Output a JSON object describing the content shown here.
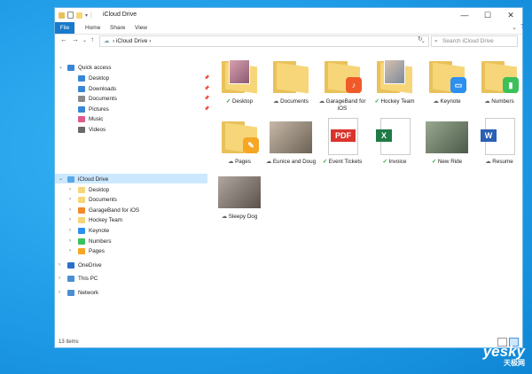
{
  "window": {
    "title": "iCloud Drive"
  },
  "ribbon": {
    "tabs": [
      "File",
      "Home",
      "Share",
      "View"
    ]
  },
  "address": {
    "path": "iCloud Drive",
    "search_placeholder": "Search iCloud Drive"
  },
  "sidebar": {
    "quick_access": {
      "label": "Quick access",
      "items": [
        "Desktop",
        "Downloads",
        "Documents",
        "Pictures",
        "Music",
        "Videos"
      ]
    },
    "icloud": {
      "label": "iCloud Drive",
      "items": [
        "Desktop",
        "Documents",
        "GarageBand for iOS",
        "Hockey Team",
        "Keynote",
        "Numbers",
        "Pages"
      ]
    },
    "onedrive": "OneDrive",
    "this_pc": "This PC",
    "network": "Network"
  },
  "items": [
    {
      "name": "Desktop",
      "kind": "photo-folder",
      "status": "ok"
    },
    {
      "name": "Documents",
      "kind": "folder",
      "status": "cloud"
    },
    {
      "name": "GarageBand for iOS",
      "kind": "app-folder",
      "app": "garageband",
      "status": "cloud"
    },
    {
      "name": "Hockey Team",
      "kind": "photo-folder",
      "status": "ok"
    },
    {
      "name": "Keynote",
      "kind": "app-folder",
      "app": "keynote",
      "status": "cloud"
    },
    {
      "name": "Numbers",
      "kind": "app-folder",
      "app": "numbers",
      "status": "cloud"
    },
    {
      "name": "Pages",
      "kind": "app-folder",
      "app": "pages",
      "status": "cloud"
    },
    {
      "name": "Eunice and Doug",
      "kind": "photo",
      "status": "cloud"
    },
    {
      "name": "Event Tickets",
      "kind": "pdf",
      "status": "ok"
    },
    {
      "name": "Invoice",
      "kind": "excel",
      "status": "ok"
    },
    {
      "name": "New Ride",
      "kind": "photo",
      "status": "ok"
    },
    {
      "name": "Resume",
      "kind": "word",
      "status": "cloud"
    },
    {
      "name": "Sleepy Dog",
      "kind": "photo",
      "status": "cloud"
    }
  ],
  "icon_labels": {
    "pdf": "PDF",
    "excel": "X",
    "word": "W"
  },
  "statusbar": {
    "count": "13 items"
  },
  "watermark": {
    "brand": "yesky",
    "sub": "天极网"
  },
  "colors": {
    "accent": "#1979ca",
    "folder": "#f6d679",
    "ok": "#2aa640"
  }
}
